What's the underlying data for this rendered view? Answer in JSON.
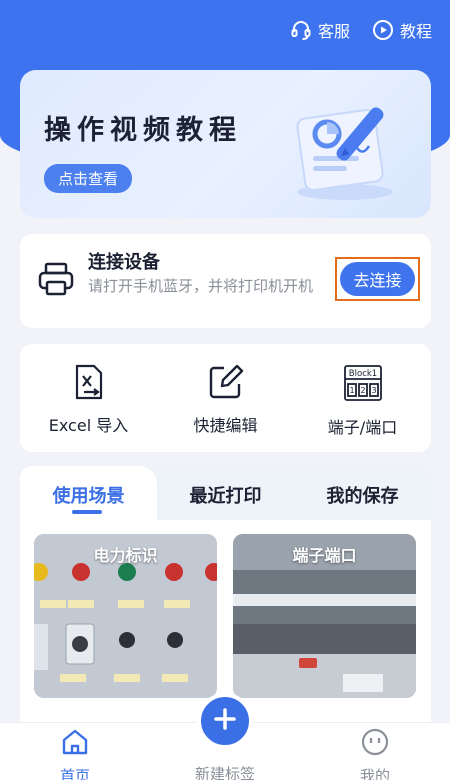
{
  "header": {
    "service_label": "客服",
    "tutorial_label": "教程"
  },
  "banner": {
    "title": "操作视频教程",
    "button_label": "点击查看"
  },
  "connect": {
    "title": "连接设备",
    "description": "请打开手机蓝牙，并将打印机开机",
    "button_label": "去连接"
  },
  "quick_actions": [
    {
      "label": "Excel 导入",
      "icon": "excel-import-icon"
    },
    {
      "label": "快捷编辑",
      "icon": "quick-edit-icon"
    },
    {
      "label": "端子/端口",
      "icon": "terminal-block-icon"
    }
  ],
  "terminal_icon_text": {
    "block": "Block1",
    "cells": [
      "1",
      "2",
      "3"
    ]
  },
  "tabs": [
    {
      "label": "使用场景",
      "active": true
    },
    {
      "label": "最近打印",
      "active": false
    },
    {
      "label": "我的保存",
      "active": false
    }
  ],
  "scenes": [
    {
      "title": "电力标识"
    },
    {
      "title": "端子端口"
    }
  ],
  "bottom_nav": [
    {
      "label": "首页",
      "active": true,
      "icon": "home-icon"
    },
    {
      "label": "新建标签",
      "active": false,
      "icon": "plus-icon"
    },
    {
      "label": "我的",
      "active": false,
      "icon": "profile-face-icon"
    }
  ],
  "colors": {
    "primary": "#3d73ee",
    "highlight_border": "#e46d1c",
    "background": "#f1f3f8"
  }
}
